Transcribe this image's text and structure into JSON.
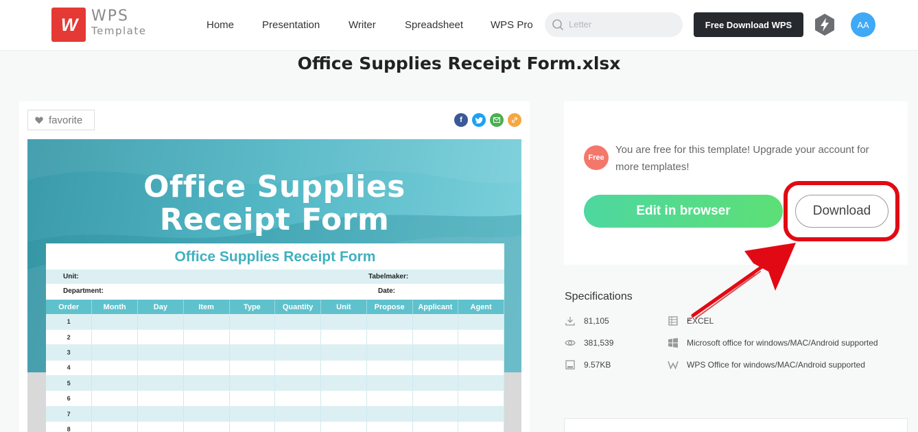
{
  "header": {
    "logo_mark": "W",
    "logo_line1": "WPS",
    "logo_line2": "Template",
    "nav": [
      "Home",
      "Presentation",
      "Writer",
      "Spreadsheet",
      "WPS Pro"
    ],
    "search_placeholder": "Letter",
    "free_download_label": "Free Download WPS",
    "avatar_initials": "AA"
  },
  "page_title": "Office Supplies Receipt Form.xlsx",
  "preview": {
    "favorite_label": "favorite",
    "share_icons": [
      "facebook-icon",
      "twitter-icon",
      "email-icon",
      "link-icon"
    ],
    "hero_line1": "Office Supplies",
    "hero_line2": "Receipt Form",
    "sheet_title": "Office Supplies Receipt Form",
    "unit_label": "Unit:",
    "tabelmaker_label": "Tabelmaker:",
    "department_label": "Department:",
    "date_label": "Date:",
    "columns": [
      "Order",
      "Month",
      "Day",
      "Item",
      "Type",
      "Quantity",
      "Unit",
      "Propose",
      "Applicant",
      "Agent"
    ],
    "rows": [
      "1",
      "2",
      "3",
      "4",
      "5",
      "6",
      "7",
      "8"
    ]
  },
  "download_panel": {
    "badge": "Free",
    "message": "You are free for this template! Upgrade your account for more templates!",
    "edit_label": "Edit in browser",
    "download_label": "Download"
  },
  "specifications": {
    "title": "Specifications",
    "downloads": "81,105",
    "views": "381,539",
    "size": "9.57KB",
    "format": "EXCEL",
    "compat_ms": "Microsoft office for windows/MAC/Android supported",
    "compat_wps": "WPS Office for windows/MAC/Android supported"
  },
  "colors": {
    "brand_red": "#e53935",
    "accent_green": "#4ed7a0",
    "highlight_red": "#e10a14",
    "teal": "#5fc1cc"
  }
}
